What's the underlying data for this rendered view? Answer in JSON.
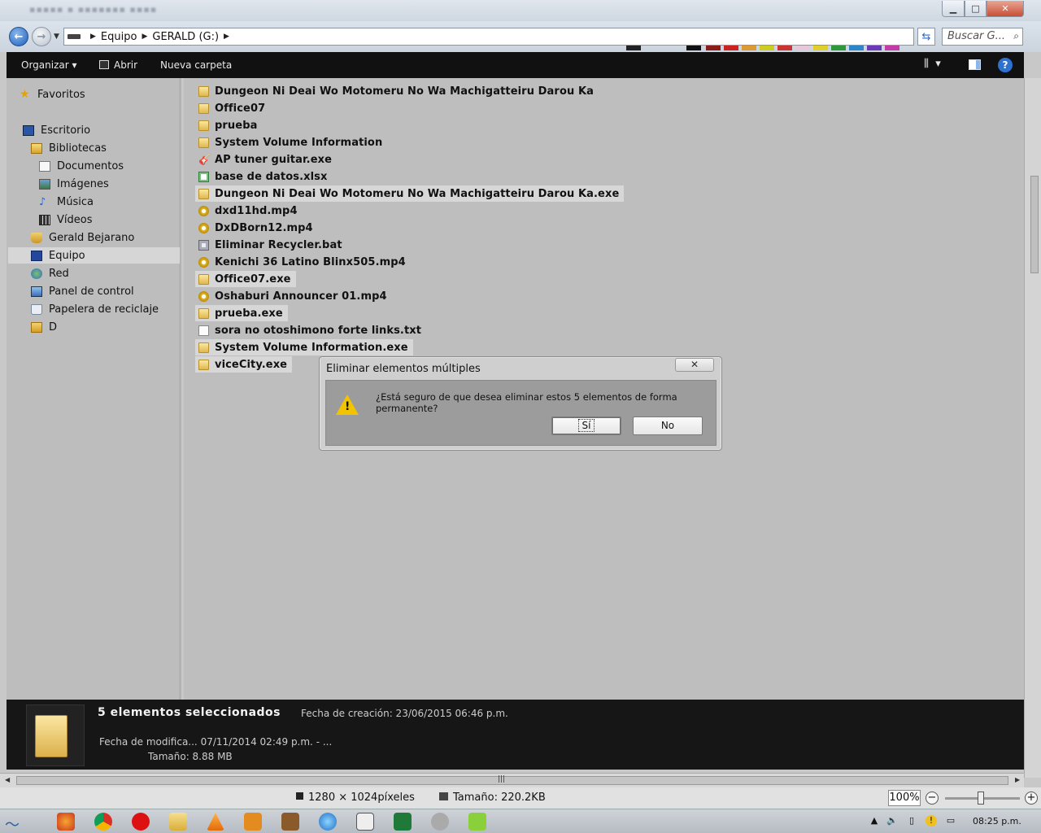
{
  "address": {
    "crumbs": [
      "Equipo",
      "GERALD (G:)"
    ],
    "search_placeholder": "Buscar G..."
  },
  "toolbar": {
    "organize": "Organizar ▾",
    "open": "Abrir",
    "new_folder": "Nueva carpeta"
  },
  "sidebar": {
    "items": [
      {
        "label": "Favoritos",
        "icon": "star-icon"
      },
      {
        "label": "Escritorio",
        "icon": "desktop-icon"
      },
      {
        "label": "Bibliotecas",
        "icon": "libraries-icon"
      },
      {
        "label": "Documentos",
        "icon": "documents-icon"
      },
      {
        "label": "Imágenes",
        "icon": "pictures-icon"
      },
      {
        "label": "Música",
        "icon": "music-icon"
      },
      {
        "label": "Vídeos",
        "icon": "videos-icon"
      },
      {
        "label": "Gerald Bejarano",
        "icon": "user-folder-icon"
      },
      {
        "label": "Equipo",
        "icon": "computer-icon"
      },
      {
        "label": "Red",
        "icon": "network-icon"
      },
      {
        "label": "Panel de control",
        "icon": "control-panel-icon"
      },
      {
        "label": "Papelera de reciclaje",
        "icon": "recycle-bin-icon"
      },
      {
        "label": "D",
        "icon": "folder-icon"
      }
    ]
  },
  "files": [
    {
      "name": "Dungeon Ni Deai Wo Motomeru No Wa Machigatteiru Darou Ka",
      "icon": "folder-icon",
      "selected": false
    },
    {
      "name": "Office07",
      "icon": "folder-icon",
      "selected": false
    },
    {
      "name": "prueba",
      "icon": "folder-icon",
      "selected": false
    },
    {
      "name": "System Volume Information",
      "icon": "folder-icon",
      "selected": false
    },
    {
      "name": "AP tuner guitar.exe",
      "icon": "guitar-icon",
      "selected": false
    },
    {
      "name": "base de datos.xlsx",
      "icon": "excel-icon",
      "selected": false
    },
    {
      "name": "Dungeon Ni Deai Wo Motomeru No Wa Machigatteiru Darou Ka.exe",
      "icon": "folder-icon",
      "selected": true
    },
    {
      "name": "dxd11hd.mp4",
      "icon": "media-icon",
      "selected": false
    },
    {
      "name": "DxDBorn12.mp4",
      "icon": "media-icon",
      "selected": false
    },
    {
      "name": "Eliminar Recycler.bat",
      "icon": "batch-icon",
      "selected": false
    },
    {
      "name": "Kenichi 36 Latino Blinx505.mp4",
      "icon": "media-icon",
      "selected": false
    },
    {
      "name": "Office07.exe",
      "icon": "folder-icon",
      "selected": true
    },
    {
      "name": "Oshaburi Announcer 01.mp4",
      "icon": "media-icon",
      "selected": false
    },
    {
      "name": "prueba.exe",
      "icon": "folder-icon",
      "selected": true
    },
    {
      "name": "sora no otoshimono forte links.txt",
      "icon": "text-file-icon",
      "selected": false
    },
    {
      "name": "System Volume Information.exe",
      "icon": "folder-icon",
      "selected": true
    },
    {
      "name": "viceCity.exe",
      "icon": "folder-icon",
      "selected": true
    }
  ],
  "details": {
    "title": "5 elementos seleccionados",
    "created": "Fecha de creación: 23/06/2015 06:46 p.m.",
    "modified": "Fecha de modifica... 07/11/2014 02:49 p.m. - ...",
    "size": "Tamaño: 8.88 MB"
  },
  "dialog": {
    "title": "Eliminar elementos múltiples",
    "message": "¿Está seguro de que desea eliminar estos 5 elementos de forma permanente?",
    "yes": "Sí",
    "no": "No",
    "close": "✕"
  },
  "viewer_status": {
    "dimensions": "1280 × 1024píxeles",
    "filesize": "Tamaño: 220.2KB",
    "zoom": "100%"
  },
  "taskbar": {
    "clock": "08:25 p.m."
  },
  "colors": {
    "toolbar_bg": "#111111",
    "dialog_body": "#9c9c9c",
    "warning": "#f2c400"
  }
}
